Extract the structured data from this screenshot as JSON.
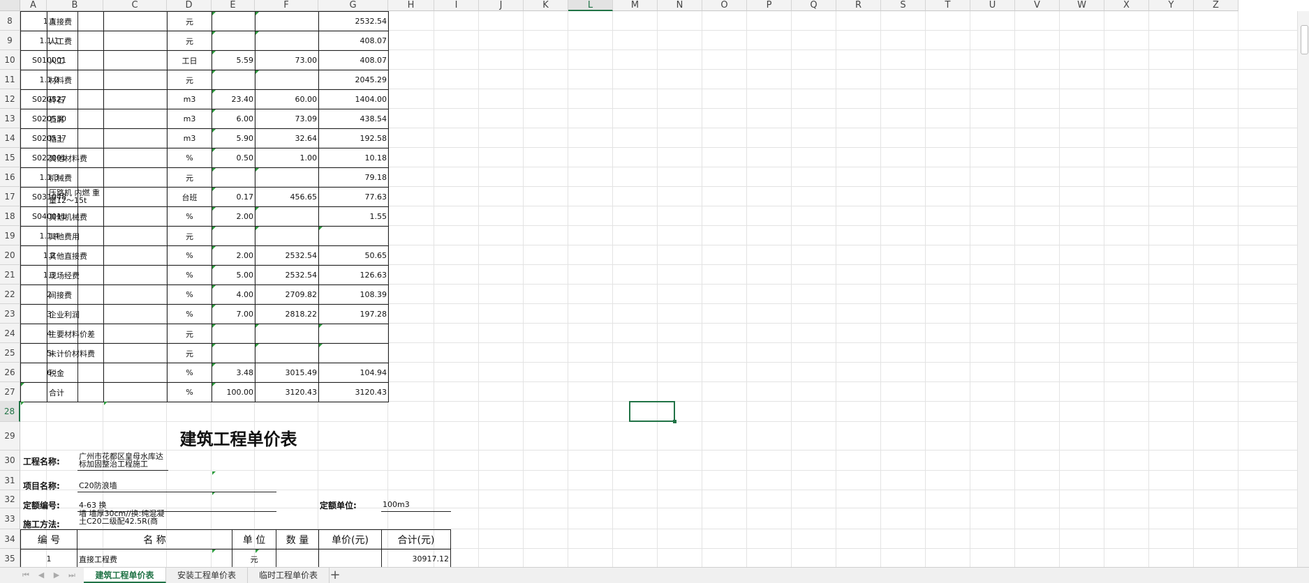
{
  "columns": [
    "A",
    "B",
    "C",
    "D",
    "E",
    "F",
    "G",
    "H",
    "I",
    "J",
    "K",
    "L",
    "M",
    "N",
    "O",
    "P",
    "Q",
    "R",
    "S",
    "T",
    "U",
    "V",
    "W",
    "X",
    "Y",
    "Z"
  ],
  "selected_column": "L",
  "selected_row": "28",
  "rows": [
    {
      "num": "8",
      "a": "1.1",
      "b": "直接费",
      "d": "元",
      "e": "",
      "f": "",
      "g": "2532.54"
    },
    {
      "num": "9",
      "a": "1.1.1",
      "b": "人工费",
      "d": "元",
      "e": "",
      "f": "",
      "g": "408.07"
    },
    {
      "num": "10",
      "a": "S010001",
      "b": "人工",
      "d": "工日",
      "e": "5.59",
      "f": "73.00",
      "g": "408.07"
    },
    {
      "num": "11",
      "a": "1.1.2",
      "b": "材料费",
      "d": "元",
      "e": "",
      "f": "",
      "g": "2045.29"
    },
    {
      "num": "12",
      "a": "S020527",
      "b": "碎石",
      "d": "m3",
      "e": "23.40",
      "f": "60.00",
      "g": "1404.00"
    },
    {
      "num": "13",
      "a": "S020530",
      "b": "石屑",
      "d": "m3",
      "e": "6.00",
      "f": "73.09",
      "g": "438.54"
    },
    {
      "num": "14",
      "a": "S020537",
      "b": "粘土",
      "d": "m3",
      "e": "5.90",
      "f": "32.64",
      "g": "192.58"
    },
    {
      "num": "15",
      "a": "S022001",
      "b": "其他材料费",
      "d": "%",
      "e": "0.50",
      "f": "1.00",
      "g": "10.18"
    },
    {
      "num": "16",
      "a": "1.1.3",
      "b": "机械费",
      "d": "元",
      "e": "",
      "f": "",
      "g": "79.18"
    },
    {
      "num": "17",
      "a": "S031048",
      "b": "压路机 内燃 重量12～15t",
      "d": "台班",
      "e": "0.17",
      "f": "456.65",
      "g": "77.63"
    },
    {
      "num": "18",
      "a": "S040011",
      "b": "其他机械费",
      "d": "%",
      "e": "2.00",
      "f": "",
      "g": "1.55"
    },
    {
      "num": "19",
      "a": "1.1.4",
      "b": "其他费用",
      "d": "元",
      "e": "",
      "f": "",
      "g": ""
    },
    {
      "num": "20",
      "a": "1.2",
      "b": "其他直接费",
      "d": "%",
      "e": "2.00",
      "f": "2532.54",
      "g": "50.65"
    },
    {
      "num": "21",
      "a": "1.3",
      "b": "现场经费",
      "d": "%",
      "e": "5.00",
      "f": "2532.54",
      "g": "126.63"
    },
    {
      "num": "22",
      "a": "2",
      "b": "间接费",
      "d": "%",
      "e": "4.00",
      "f": "2709.82",
      "g": "108.39"
    },
    {
      "num": "23",
      "a": "3",
      "b": "企业利润",
      "d": "%",
      "e": "7.00",
      "f": "2818.22",
      "g": "197.28"
    },
    {
      "num": "24",
      "a": "4",
      "b": "主要材料价差",
      "d": "元",
      "e": "",
      "f": "",
      "g": ""
    },
    {
      "num": "25",
      "a": "5",
      "b": "未计价材料费",
      "d": "元",
      "e": "",
      "f": "",
      "g": ""
    },
    {
      "num": "26",
      "a": "6",
      "b": "税金",
      "d": "%",
      "e": "3.48",
      "f": "3015.49",
      "g": "104.94"
    },
    {
      "num": "27",
      "a": "",
      "b": "合计",
      "d": "%",
      "e": "100.00",
      "f": "3120.43",
      "g": "3120.43"
    }
  ],
  "lower": {
    "r28": "28",
    "r29": "29",
    "r30": "30",
    "r31": "31",
    "r32": "32",
    "r33": "33",
    "r34": "34",
    "r35": "35",
    "title": "建筑工程单价表",
    "project_label": "工程名称:",
    "project_value": "广州市花都区皇母水库达标加固整治工程施工",
    "item_label": "项目名称:",
    "item_value": "C20防浪墙",
    "quota_label": "定额编号:",
    "quota_value": "4-63 换",
    "quota_unit_label": "定额单位:",
    "quota_unit_value": "100m3",
    "method_label": "施工方法:",
    "method_value": "墙 墙厚30cm//换:纯混凝土C20二级配42.5R(商",
    "hdr_code": "编 号",
    "hdr_name": "名 称",
    "hdr_unit": "单 位",
    "hdr_qty": "数 量",
    "hdr_price": "单价(元)",
    "hdr_total": "合计(元)",
    "r35_code": "1",
    "r35_name": "直接工程费",
    "r35_unit": "元",
    "r35_total": "30917.12"
  },
  "tabs": [
    "建筑工程单价表",
    "安装工程单价表",
    "临时工程单价表"
  ],
  "active_tab": 0,
  "add_tab_icon": "+"
}
